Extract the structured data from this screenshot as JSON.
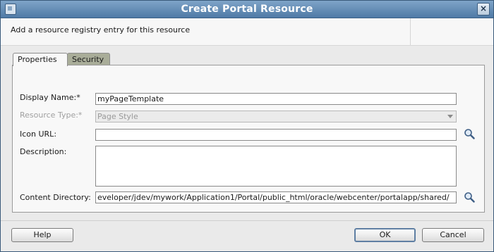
{
  "window": {
    "title": "Create Portal Resource"
  },
  "header": {
    "description": "Add a resource registry entry for this resource"
  },
  "tabs": [
    {
      "label": "Properties",
      "selected": true
    },
    {
      "label": "Security",
      "selected": false
    }
  ],
  "form": {
    "display_name": {
      "label": "Display Name:*",
      "value": "myPageTemplate"
    },
    "resource_type": {
      "label": "Resource Type:*",
      "value": "Page Style",
      "enabled": false
    },
    "icon_url": {
      "label": "Icon URL:",
      "value": ""
    },
    "description": {
      "label": "Description:",
      "value": ""
    },
    "content_directory": {
      "label": "Content Directory:",
      "value": "eveloper/jdev/mywork/Application1/Portal/public_html/oracle/webcenter/portalapp/shared/"
    }
  },
  "buttons": {
    "help": "Help",
    "ok": "OK",
    "cancel": "Cancel"
  },
  "icons": {
    "search": "search-icon",
    "window": "window-icon",
    "close": "close-icon"
  },
  "colors": {
    "titlebar": "#5a84ae",
    "security_tab": "#a9ad99"
  }
}
